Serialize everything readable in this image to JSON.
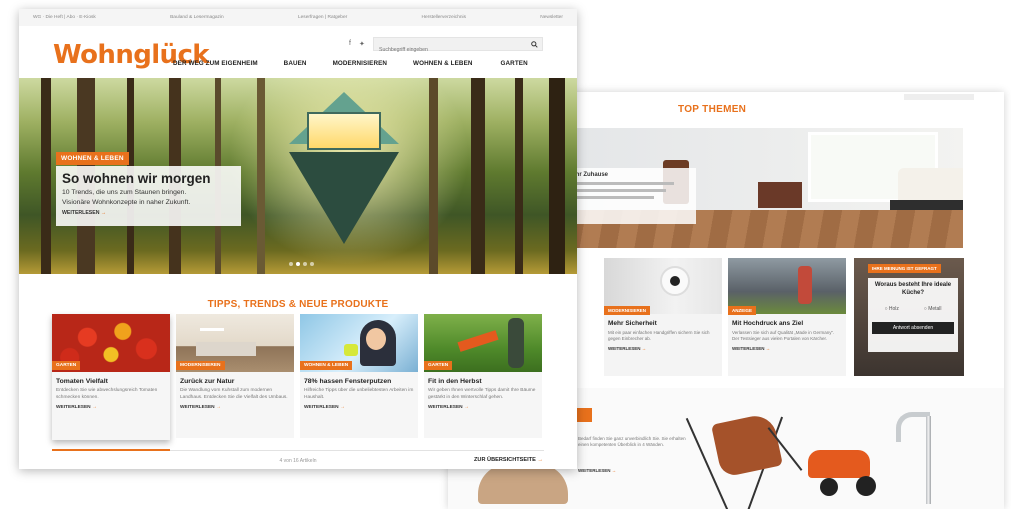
{
  "front": {
    "topbar": [
      "WG · Die Heft | Abo · E-Kiosk",
      "Bauland & Lesermagazin",
      "Leserfragen | Ratgeber",
      "Herstellerverzeichnis",
      "Newsletter"
    ],
    "logo": "Wohnglück",
    "search": {
      "placeholder": "Suchbegriff eingeben"
    },
    "nav": [
      "DER WEG ZUM EIGENHEIM",
      "BAUEN",
      "MODERNISIEREN",
      "WOHNEN & LEBEN",
      "GARTEN"
    ],
    "hero": {
      "tag": "WOHNEN & LEBEN",
      "title": "So wohnen wir morgen",
      "text_line1": "10 Trends, die uns zum Staunen bringen.",
      "text_line2": "Visionäre Wohnkonzepte in naher Zukunft.",
      "more": "WEITERLESEN"
    },
    "tips_heading": "TIPPS, TRENDS & NEUE PRODUKTE",
    "cards": [
      {
        "tag": "GARTEN",
        "title": "Tomaten Vielfalt",
        "text": "Entdecken Sie wie abwechslungsreich Tomaten schmecken können.",
        "more": "WEITERLESEN"
      },
      {
        "tag": "MODERNISIEREN",
        "title": "Zurück zur Natur",
        "text": "Die Wandlung vom Kuhstall zum modernen Landhaus. Entdecken Sie die Vielfalt des Umbaus.",
        "more": "WEITERLESEN"
      },
      {
        "tag": "WOHNEN & LEBEN",
        "title": "78% hassen Fensterputzen",
        "text": "Hilfreiche Tipps über die unbeliebtesten Arbeiten im Haushalt.",
        "more": "WEITERLESEN"
      },
      {
        "tag": "GARTEN",
        "title": "Fit in den Herbst",
        "text": "Wir geben Ihnen wertvolle Tipps damit Ihre Bäume gestärkt in den Winterschlaf gehen.",
        "more": "WEITERLESEN"
      }
    ],
    "pager": "4 von 16 Artikeln",
    "overview": "ZUR ÜBERSICHTSEITE"
  },
  "back": {
    "heading": "TOP THEMEN",
    "hero_title": "Ihr Zuhause",
    "cards": [
      {
        "tag": "MODERNISIEREN",
        "title": "Mehr Sicherheit",
        "text": "Mit ein paar einfachen Handgriffen sichern Sie sich gegen Einbrecher ab.",
        "more": "WEITERLESEN"
      },
      {
        "tag": "ANZEIGE",
        "title": "Mit Hochdruck ans Ziel",
        "text": "Verlassen Sie sich auf Qualität „Made in Germany“. Der Testsieger aus vielen Portalen von Kärcher.",
        "more": "WEITERLESEN"
      }
    ],
    "poll": {
      "tag": "IHRE MEINUNG IST GEFRAGT",
      "question": "Woraus besteht Ihre ideale Küche?",
      "options": [
        "Holz",
        "Metall"
      ],
      "button": "Antwort absenden"
    },
    "lower_text": "Bedarf finden Sie ganz unverbindlich Sie. Sie erhalten einen kompetenten Überblick in 4 Wänden.",
    "lower_more": "WEITERLESEN"
  },
  "colors": {
    "accent": "#e8711c",
    "text": "#222222"
  }
}
